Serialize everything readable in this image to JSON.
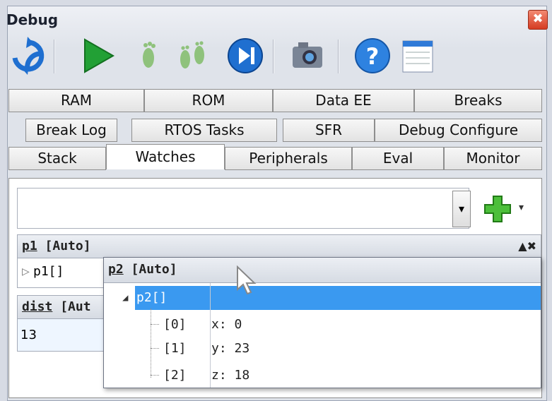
{
  "window": {
    "title": "Debug",
    "close_label": "✖"
  },
  "toolbar": {
    "buttons": [
      {
        "name": "refresh-icon"
      },
      {
        "name": "run-icon"
      },
      {
        "name": "step-into-icon"
      },
      {
        "name": "step-over-icon"
      },
      {
        "name": "step-out-icon"
      },
      {
        "name": "snapshot-icon"
      },
      {
        "name": "help-icon"
      },
      {
        "name": "window-layout-icon"
      }
    ]
  },
  "tabs": {
    "row1": [
      "RAM",
      "ROM",
      "Data EE",
      "Breaks"
    ],
    "row2": [
      "Break Log",
      "RTOS Tasks",
      "SFR",
      "Debug Configure"
    ],
    "row3": [
      "Stack",
      "Watches",
      "Peripherals",
      "Eval",
      "Monitor"
    ],
    "active": "Watches"
  },
  "watch_input": {
    "value": "",
    "arrow": "▾",
    "add_dropdown": "▾"
  },
  "watches": {
    "p1": {
      "name": "p1",
      "mode": "[Auto]",
      "row": "p1[]",
      "controls": "▲✖"
    },
    "dist": {
      "name": "dist",
      "mode": "[Aut",
      "value": "13"
    }
  },
  "popup": {
    "name": "p2",
    "mode": "[Auto]",
    "root": "p2[]",
    "rows": [
      {
        "index": "[0]",
        "value": "x: 0"
      },
      {
        "index": "[1]",
        "value": "y: 23"
      },
      {
        "index": "[2]",
        "value": "z: 18"
      }
    ]
  },
  "colors": {
    "selection": "#3a99f0",
    "accent_green": "#22a035",
    "close_red": "#d53b22"
  }
}
